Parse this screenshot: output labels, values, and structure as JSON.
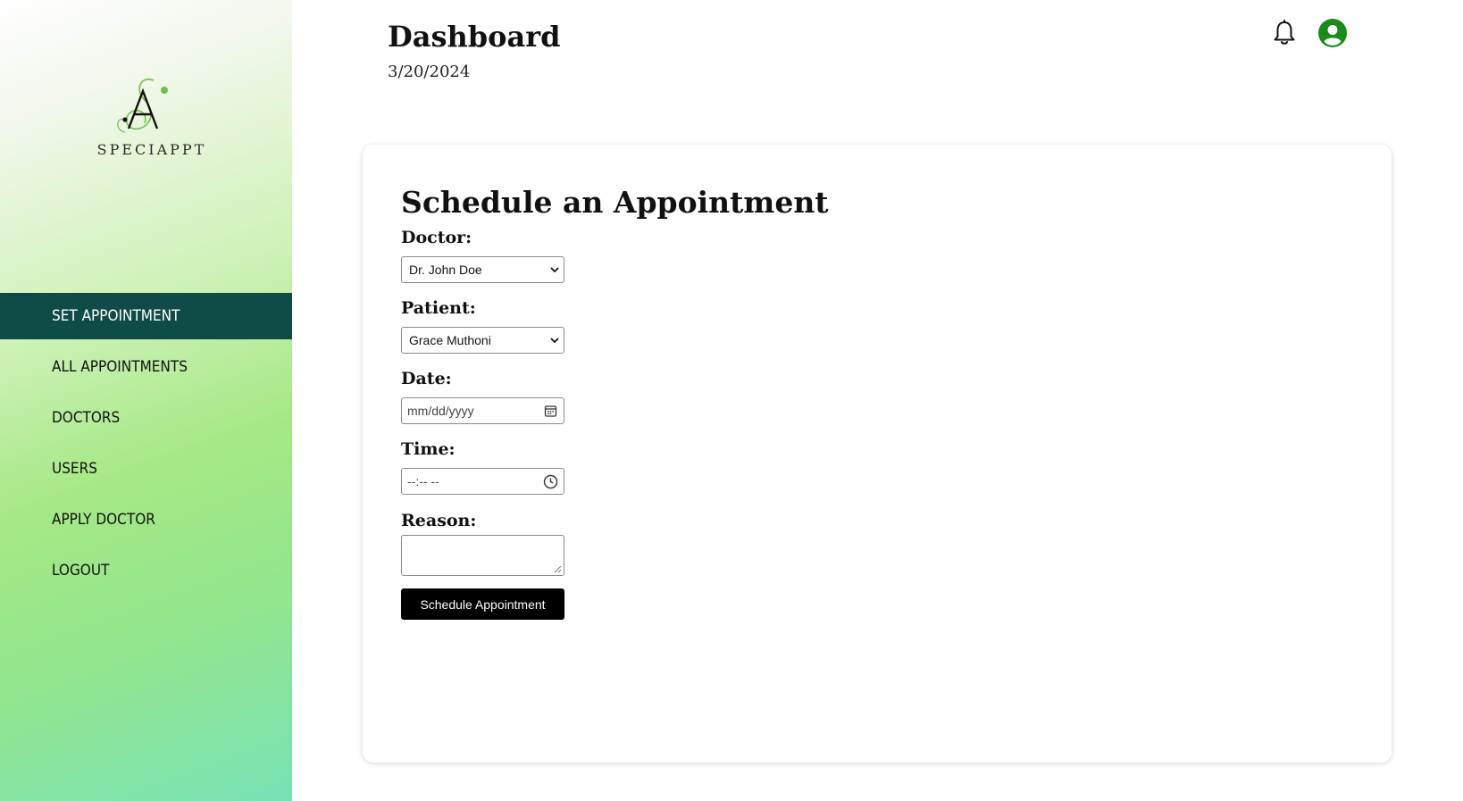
{
  "sidebar": {
    "logo_text": "SPECIAPPT",
    "items": [
      {
        "label": "SET APPOINTMENT",
        "active": true
      },
      {
        "label": "ALL APPOINTMENTS",
        "active": false
      },
      {
        "label": "DOCTORS",
        "active": false
      },
      {
        "label": "USERS",
        "active": false
      },
      {
        "label": "APPLY DOCTOR",
        "active": false
      },
      {
        "label": "LOGOUT",
        "active": false
      }
    ]
  },
  "header": {
    "title": "Dashboard",
    "date": "3/20/2024",
    "icons": [
      "bell-icon",
      "user-circle-icon"
    ]
  },
  "form": {
    "title": "Schedule an Appointment",
    "doctor_label": "Doctor:",
    "doctor_value": "Dr. John Doe",
    "patient_label": "Patient:",
    "patient_value": "Grace Muthoni",
    "date_label": "Date:",
    "date_placeholder": "mm/dd/yyyy",
    "time_label": "Time:",
    "time_placeholder": "--:-- --",
    "reason_label": "Reason:",
    "reason_value": "",
    "submit_label": "Schedule Appointment"
  },
  "colors": {
    "active_nav": "#0f4c48",
    "avatar": "#1a8a1a",
    "logo_green": "#6fbf4a",
    "button": "#000000"
  }
}
